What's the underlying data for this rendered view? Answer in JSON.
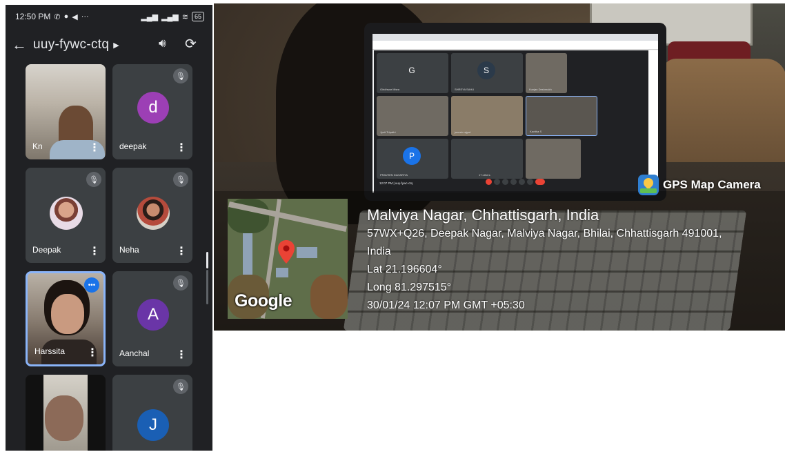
{
  "phone": {
    "status_bar": {
      "time": "12:50 PM",
      "battery": "65"
    },
    "header": {
      "meeting_code": "uuy-fywc-ctq"
    },
    "participants": [
      {
        "name": "Kn",
        "type": "video",
        "muted": false
      },
      {
        "name": "deepak",
        "type": "avatar",
        "letter": "d",
        "color": "#9c3fb5",
        "muted": true
      },
      {
        "name": "Deepak",
        "type": "photo",
        "muted": true
      },
      {
        "name": "Neha",
        "type": "photo",
        "muted": true
      },
      {
        "name": "Harssita",
        "type": "video",
        "speaking": true
      },
      {
        "name": "Aanchal",
        "type": "avatar",
        "letter": "A",
        "color": "#6a35a7",
        "muted": true
      },
      {
        "name": "",
        "type": "video",
        "muted": false
      },
      {
        "name": "",
        "type": "avatar",
        "letter": "J",
        "color": "#1a5fb4",
        "muted": true
      }
    ]
  },
  "photo": {
    "laptop_meet": {
      "tiles": [
        {
          "letter": "G",
          "label": "Giridhwar Misra"
        },
        {
          "letter": "S",
          "label": "SHREYA SAHU"
        },
        {
          "letter": "",
          "label": "Kunjan Deshmukh"
        },
        {
          "letter": "",
          "label": "Jyoti Tripathi"
        },
        {
          "letter": "",
          "label": "jonneir rajput"
        },
        {
          "letter": "",
          "label": "Kavitha S"
        },
        {
          "letter": "P",
          "label": "PRAVEEN DAHARIYA"
        },
        {
          "letter": "",
          "label": "17 others"
        },
        {
          "letter": "",
          "label": ""
        }
      ],
      "time": "12:07 PM | uuy-fywc-ctq"
    },
    "gps": {
      "brand": "GPS Map Camera",
      "map_logo": "Google",
      "title": "Malviya Nagar, Chhattisgarh, India",
      "address_line1": "57WX+Q26, Deepak Nagar, Malviya Nagar, Bhilai, Chhattisgarh 491001,",
      "address_line2": "India",
      "lat": "Lat 21.196604°",
      "long": "Long 81.297515°",
      "datetime": "30/01/24 12:07 PM GMT +05:30"
    }
  }
}
